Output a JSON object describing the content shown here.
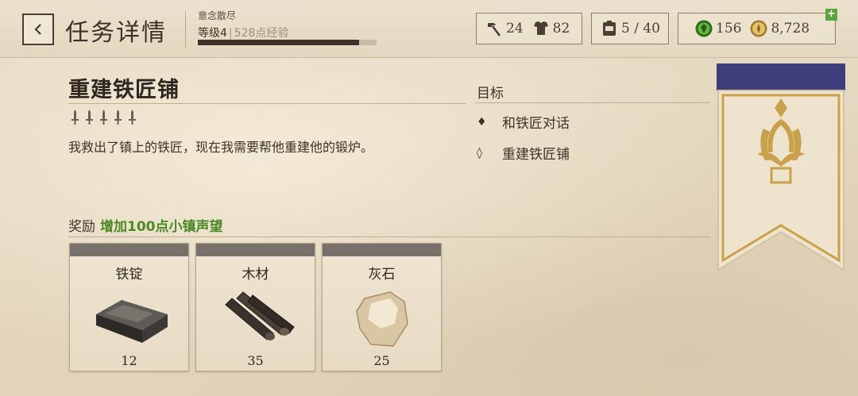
{
  "header": {
    "title": "任务详情",
    "subtitle": "意念散尽",
    "level_label": "等级4",
    "xp_label": "528点经验",
    "xp_progress": 0.9,
    "stats": [
      {
        "icon": "hammer-icon",
        "value": "24"
      },
      {
        "icon": "armor-icon",
        "value": "82"
      },
      {
        "icon": "backpack-icon",
        "value": "5 / 40"
      },
      {
        "icon": "gem-icon",
        "value": "156"
      },
      {
        "icon": "gold-coin-icon",
        "value": "8,728"
      }
    ],
    "add_currency": "+"
  },
  "quest": {
    "title": "重建铁匠铺",
    "difficulty": 5,
    "description": "我救出了镇上的铁匠，现在我需要帮他重建他的锻炉。"
  },
  "objectives": {
    "header": "目标",
    "items": [
      {
        "bullet": "♦",
        "label": "和铁匠对话",
        "done": true
      },
      {
        "bullet": "◊",
        "label": "重建铁匠铺",
        "done": false
      }
    ]
  },
  "reward": {
    "label": "奖励",
    "text": "增加100点小镇声望"
  },
  "materials": [
    {
      "name": "铁锭",
      "qty": "12",
      "icon": "iron-ingot-icon"
    },
    {
      "name": "木材",
      "qty": "35",
      "icon": "wood-logs-icon"
    },
    {
      "name": "灰石",
      "qty": "25",
      "icon": "limestone-icon"
    }
  ],
  "colors": {
    "accent_green": "#4c8a25",
    "banner_blue": "#3c3f7a",
    "banner_gold": "#c9a14a"
  }
}
